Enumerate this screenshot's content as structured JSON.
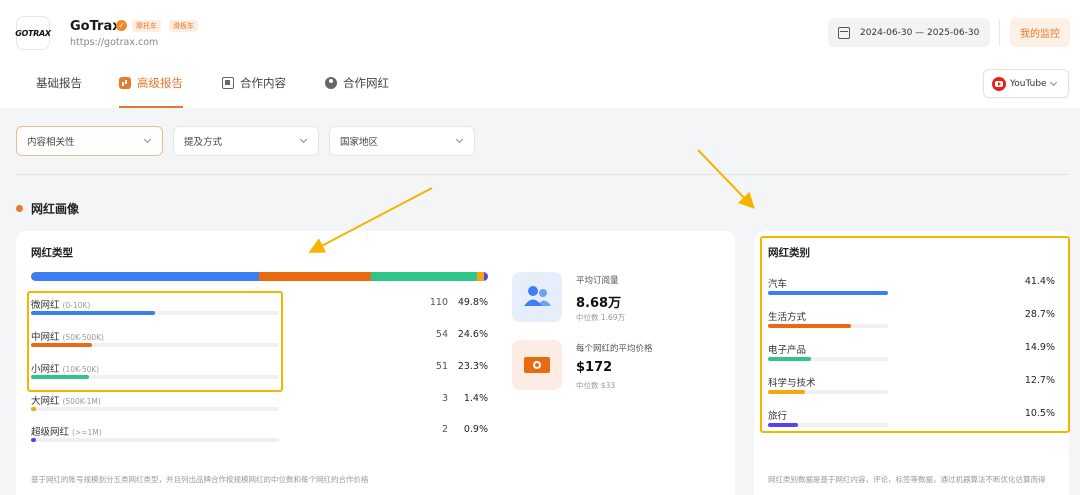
{
  "header": {
    "logo_text": "GOTRAX",
    "brand_name": "GoTrax",
    "tags": [
      "摩托车",
      "滑板车"
    ],
    "url": "https://gotrax.com",
    "date_range": "2024-06-30 — 2025-06-30",
    "monitor_button": "我的监控",
    "platform": "YouTube"
  },
  "tabs": [
    {
      "label": "基础报告",
      "icon": "grid-icon",
      "active": false
    },
    {
      "label": "高级报告",
      "icon": "chart-icon",
      "active": true
    },
    {
      "label": "合作内容",
      "icon": "content-icon",
      "active": false
    },
    {
      "label": "合作网红",
      "icon": "user-icon",
      "active": false
    }
  ],
  "filters": [
    {
      "label": "内容相关性"
    },
    {
      "label": "提及方式"
    },
    {
      "label": "国家地区"
    }
  ],
  "section_title": "网红画像",
  "influencer_types": {
    "title": "网红类型",
    "rows": [
      {
        "name": "微网红",
        "range": "(0-10K)",
        "count": "110",
        "pct": "49.8%",
        "value": 49.8,
        "color": "#3b7ff0"
      },
      {
        "name": "中网红",
        "range": "(50K-500K)",
        "count": "54",
        "pct": "24.6%",
        "value": 24.6,
        "color": "#ea6a12"
      },
      {
        "name": "小网红",
        "range": "(10K-50K)",
        "count": "51",
        "pct": "23.3%",
        "value": 23.3,
        "color": "#2fc48a"
      },
      {
        "name": "大网红",
        "range": "(500K-1M)",
        "count": "3",
        "pct": "1.4%",
        "value": 1.4,
        "color": "#f5a80c"
      },
      {
        "name": "超级网红",
        "range": "(>=1M)",
        "count": "2",
        "pct": "0.9%",
        "value": 0.9,
        "color": "#5b3ff0"
      }
    ],
    "footnote": "基于网红的账号规模划分五类网红类型，并且列出品牌合作按规模网红的中位数和每个网红的合作价格"
  },
  "metrics": [
    {
      "title": "平均订阅量",
      "value": "8.68万",
      "sub": "中位数 1.69万",
      "icon": "people-icon",
      "bg": "#e6eefc"
    },
    {
      "title": "每个网红的平均价格",
      "value": "$172",
      "sub": "中位数 $33",
      "icon": "money-icon",
      "bg": "#fdece4"
    }
  ],
  "influencer_categories": {
    "title": "网红类别",
    "rows": [
      {
        "name": "汽车",
        "pct": "41.4%",
        "value": 41.4,
        "color": "#3b7ff0"
      },
      {
        "name": "生活方式",
        "pct": "28.7%",
        "value": 28.7,
        "color": "#ea6a12"
      },
      {
        "name": "电子产品",
        "pct": "14.9%",
        "value": 14.9,
        "color": "#2fc48a"
      },
      {
        "name": "科学与技术",
        "pct": "12.7%",
        "value": 12.7,
        "color": "#f5a80c"
      },
      {
        "name": "旅行",
        "pct": "10.5%",
        "value": 10.5,
        "color": "#5b3ff0"
      }
    ],
    "footnote": "网红类别数据是基于网红内容，评论，标签等数据，通过机器算法不断优化估算而得"
  }
}
